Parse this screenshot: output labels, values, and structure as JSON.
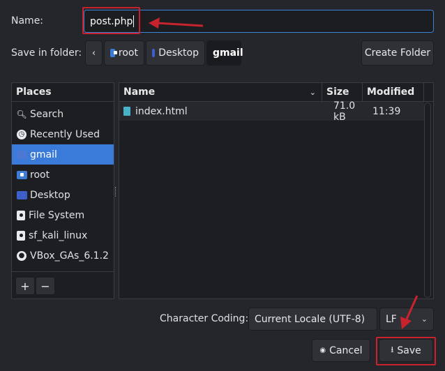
{
  "name_row": {
    "label": "Name:",
    "value": "post.php"
  },
  "folder_row": {
    "label": "Save in folder:",
    "back_icon": "chevron-left-icon",
    "crumbs": [
      "root",
      "Desktop",
      "gmail"
    ],
    "create_folder": "Create Folder"
  },
  "places": {
    "header": "Places",
    "items": [
      {
        "label": "Search",
        "icon": "search-icon"
      },
      {
        "label": "Recently Used",
        "icon": "recent-icon"
      },
      {
        "label": "gmail",
        "icon": "folder-icon",
        "selected": true
      },
      {
        "label": "root",
        "icon": "home-folder-icon"
      },
      {
        "label": "Desktop",
        "icon": "desktop-folder-icon"
      },
      {
        "label": "File System",
        "icon": "drive-icon"
      },
      {
        "label": "sf_kali_linux",
        "icon": "network-drive-icon"
      },
      {
        "label": "VBox_GAs_6.1.2",
        "icon": "disc-icon"
      }
    ],
    "add": "+",
    "remove": "−"
  },
  "files": {
    "columns": {
      "name": "Name",
      "size": "Size",
      "modified": "Modified"
    },
    "rows": [
      {
        "name": "index.html",
        "size": "71.0 kB",
        "modified": "11:39"
      }
    ]
  },
  "bottom": {
    "coding_label": "Character Coding:",
    "coding_value": "Current Locale (UTF-8)",
    "line_ending": "LF",
    "cancel": "Cancel",
    "save": "Save"
  },
  "colors": {
    "accent": "#3a7ad8",
    "annotation": "#c8232c",
    "background": "#24262b"
  }
}
